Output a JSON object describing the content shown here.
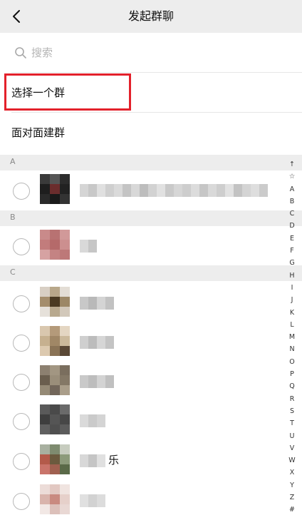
{
  "header": {
    "title": "发起群聊",
    "back_icon": "chevron-left-icon"
  },
  "search": {
    "placeholder": "搜索",
    "icon": "search-icon"
  },
  "options": [
    {
      "label": "选择一个群",
      "highlighted": true
    },
    {
      "label": "面对面建群",
      "highlighted": false
    }
  ],
  "highlight_color": "#e3212b",
  "sections": [
    {
      "letter": "A"
    },
    {
      "letter": "B"
    },
    {
      "letter": "C"
    }
  ],
  "contacts": [
    {
      "section": "A",
      "name_suffix": ""
    },
    {
      "section": "B",
      "name_suffix": ""
    },
    {
      "section": "C",
      "name_suffix": ""
    },
    {
      "section": "C",
      "name_suffix": ""
    },
    {
      "section": "C",
      "name_suffix": ""
    },
    {
      "section": "C",
      "name_suffix": ""
    },
    {
      "section": "C",
      "name_suffix": "乐"
    },
    {
      "section": "C",
      "name_suffix": ""
    }
  ],
  "index_bar": [
    "↑",
    "☆",
    "A",
    "B",
    "C",
    "D",
    "E",
    "F",
    "G",
    "H",
    "I",
    "J",
    "K",
    "L",
    "M",
    "N",
    "O",
    "P",
    "Q",
    "R",
    "S",
    "T",
    "U",
    "V",
    "W",
    "X",
    "Y",
    "Z",
    "#"
  ]
}
